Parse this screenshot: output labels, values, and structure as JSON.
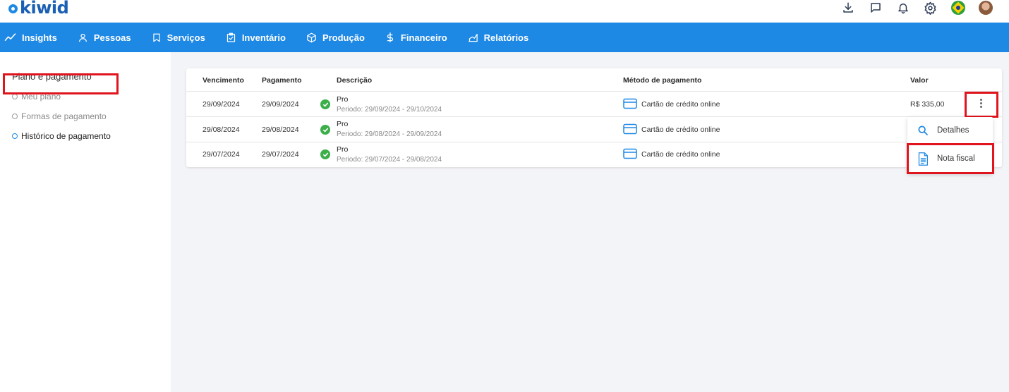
{
  "brand": {
    "logo_text": "kiwid",
    "accent": "#1e88e5"
  },
  "nav": {
    "items": [
      {
        "label": "Insights",
        "icon": "trend-icon"
      },
      {
        "label": "Pessoas",
        "icon": "user-icon"
      },
      {
        "label": "Serviços",
        "icon": "bookmark-icon"
      },
      {
        "label": "Inventário",
        "icon": "clipboard-icon"
      },
      {
        "label": "Produção",
        "icon": "box-icon"
      },
      {
        "label": "Financeiro",
        "icon": "dollar-icon"
      },
      {
        "label": "Relatórios",
        "icon": "chart-icon"
      }
    ]
  },
  "sidebar": {
    "title": "Plano e pagamento",
    "items": [
      {
        "label": "Meu plano"
      },
      {
        "label": "Formas de pagamento"
      },
      {
        "label": "Histórico de pagamento"
      }
    ]
  },
  "table": {
    "headers": [
      "Vencimento",
      "Pagamento",
      "Descrição",
      "Método de pagamento",
      "Valor"
    ],
    "rows": [
      {
        "vencimento": "29/09/2024",
        "pagamento": "29/09/2024",
        "plan": "Pro",
        "period": "Periodo: 29/09/2024 - 29/10/2024",
        "method": "Cartão de crédito online",
        "valor": "R$ 335,00"
      },
      {
        "vencimento": "29/08/2024",
        "pagamento": "29/08/2024",
        "plan": "Pro",
        "period": "Periodo: 29/08/2024 - 29/09/2024",
        "method": "Cartão de crédito online",
        "valor": ""
      },
      {
        "vencimento": "29/07/2024",
        "pagamento": "29/07/2024",
        "plan": "Pro",
        "period": "Periodo: 29/07/2024 - 29/08/2024",
        "method": "Cartão de crédito online",
        "valor": ""
      }
    ]
  },
  "dropdown": {
    "items": [
      {
        "label": "Detalhes",
        "icon": "search-icon"
      },
      {
        "label": "Nota fiscal",
        "icon": "document-icon"
      }
    ]
  }
}
